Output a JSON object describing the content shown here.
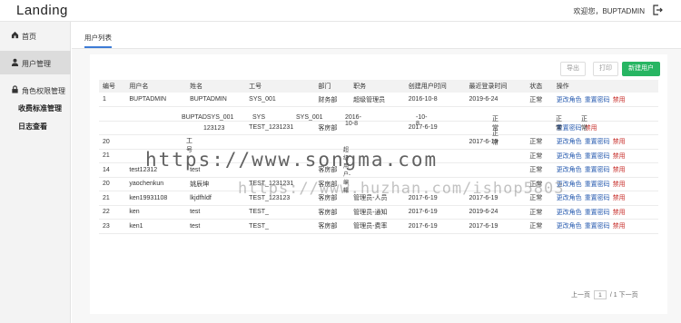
{
  "header": {
    "logo": "Landing",
    "welcome": "欢迎您，BUPTADMIN"
  },
  "sidebar": {
    "items": [
      {
        "label": "首页",
        "icon": "home-icon"
      },
      {
        "label": "用户管理",
        "icon": "user-icon"
      },
      {
        "label": "角色权限管理",
        "icon": "lock-icon"
      }
    ],
    "subitems": [
      "收费标准管理",
      "日志查看"
    ]
  },
  "tabs": [
    {
      "label": "用户列表"
    }
  ],
  "toolbar": {
    "export": "导出",
    "print": "打印",
    "new_user": "新建用户"
  },
  "table": {
    "columns": [
      "编号",
      "用户名",
      "姓名",
      "工号",
      "部门",
      "职务",
      "创建用户时间",
      "最近登录时间",
      "状态",
      "操作"
    ],
    "rows": [
      [
        "1",
        "BUPTADMIN",
        "BUPTADMIN",
        "SYS_001",
        "财务部",
        "超级管理员",
        "2016-10-8",
        "2019-6-24",
        "正常"
      ],
      [
        "",
        "",
        "",
        "",
        "",
        "",
        "",
        "",
        ""
      ],
      [
        "",
        "",
        "",
        "TEST_1231231",
        "客房部",
        "",
        "2017-6-19",
        "",
        ""
      ],
      [
        "20",
        "",
        "",
        "",
        "",
        "",
        "",
        "2017-6-19",
        "正常"
      ],
      [
        "21",
        "",
        "",
        "",
        "",
        "",
        "",
        "",
        "正常"
      ],
      [
        "14",
        "test12312",
        "test",
        "",
        "客房部",
        "",
        "",
        "",
        "正常"
      ],
      [
        "20",
        "yaochenkun",
        "姚辰坤",
        "TEST_1231231",
        "客房部",
        "",
        "",
        "",
        "正常"
      ],
      [
        "21",
        "ken19931108",
        "lkjdfhldf",
        "TEST_123123",
        "客房部",
        "管理员-人员",
        "2017-6-19",
        "2017-6-19",
        "正常"
      ],
      [
        "22",
        "ken",
        "test",
        "TEST_",
        "客房部",
        "管理员-通知",
        "2017-6-19",
        "2019-6-24",
        "正常"
      ],
      [
        "23",
        "ken1",
        "test",
        "TEST_",
        "客房部",
        "管理员-费率",
        "2017-6-19",
        "2017-6-19",
        "正常"
      ]
    ],
    "actions": [
      "更改角色",
      "重置密码",
      "禁用"
    ],
    "ghost_row": [
      "BUPTADSYS_001",
      "SYS",
      "SYS_001",
      "2016-10-8",
      "-10-8",
      "正常",
      "正常",
      "正常"
    ],
    "ghost_row2": [
      "123123",
      "工号",
      "超级用户-编辑",
      "正常"
    ]
  },
  "pagination": {
    "prev": "上一页",
    "current": "1",
    "total": "/ 1",
    "next": "下一页"
  },
  "watermark": {
    "line1": "https://www.songma.com",
    "line2": "https://www.huzhan.com/ishop5803"
  }
}
